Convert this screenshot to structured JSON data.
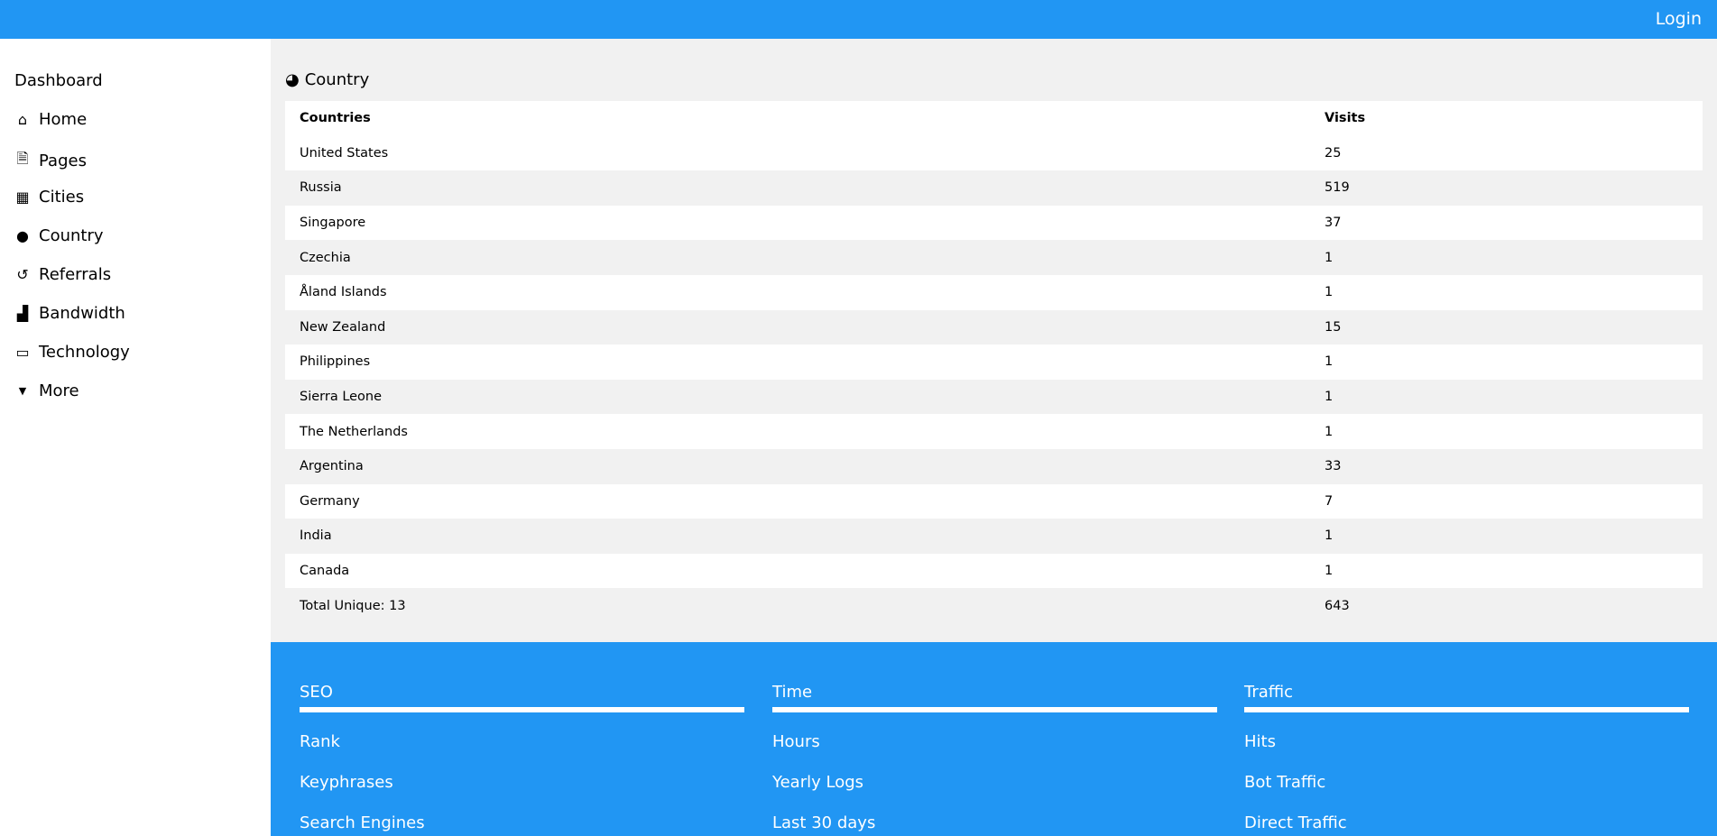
{
  "header": {
    "login_label": "Login"
  },
  "sidebar": {
    "title": "Dashboard",
    "items": [
      {
        "label": "Home",
        "icon": "home-icon"
      },
      {
        "label": "Pages",
        "icon": "file-icon"
      },
      {
        "label": "Cities",
        "icon": "building-icon"
      },
      {
        "label": "Country",
        "icon": "globe-icon"
      },
      {
        "label": "Referrals",
        "icon": "history-icon"
      },
      {
        "label": "Bandwidth",
        "icon": "bar-chart-icon"
      },
      {
        "label": "Technology",
        "icon": "desktop-icon"
      },
      {
        "label": "More",
        "icon": "caret-down-icon"
      }
    ]
  },
  "main": {
    "title": "Country",
    "table": {
      "headers": [
        "Countries",
        "Visits"
      ],
      "rows": [
        [
          "United States",
          "25"
        ],
        [
          "Russia",
          "519"
        ],
        [
          "Singapore",
          "37"
        ],
        [
          "Czechia",
          "1"
        ],
        [
          "Åland Islands",
          "1"
        ],
        [
          "New Zealand",
          "15"
        ],
        [
          "Philippines",
          "1"
        ],
        [
          "Sierra Leone",
          "1"
        ],
        [
          "The Netherlands",
          "1"
        ],
        [
          "Argentina",
          "33"
        ],
        [
          "Germany",
          "7"
        ],
        [
          "India",
          "1"
        ],
        [
          "Canada",
          "1"
        ],
        [
          "Total Unique: 13",
          "643"
        ]
      ]
    }
  },
  "footer": {
    "columns": [
      {
        "title": "SEO",
        "links": [
          "Rank",
          "Keyphrases",
          "Search Engines"
        ]
      },
      {
        "title": "Time",
        "links": [
          "Hours",
          "Yearly Logs",
          "Last 30 days"
        ]
      },
      {
        "title": "Traffic",
        "links": [
          "Hits",
          "Bot Traffic",
          "Direct Traffic"
        ]
      }
    ]
  }
}
